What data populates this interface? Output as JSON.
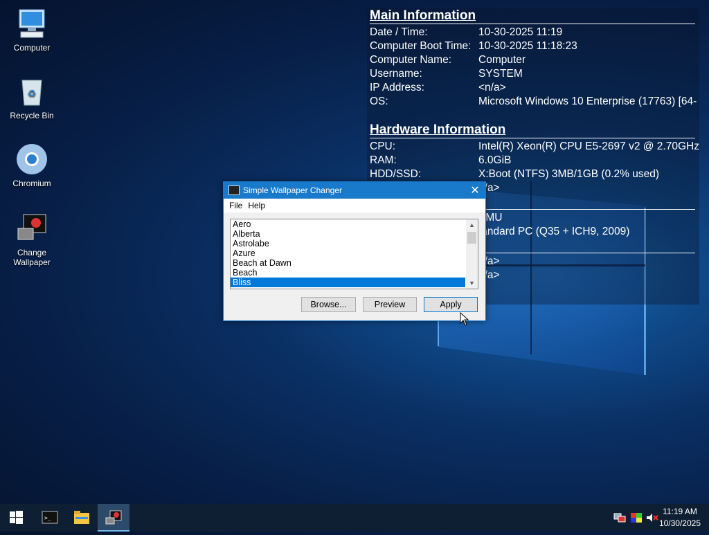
{
  "desktop": {
    "icons": [
      {
        "label": "Computer",
        "icon": "computer-icon"
      },
      {
        "label": "Recycle Bin",
        "icon": "recycle-bin-icon"
      },
      {
        "label": "Chromium",
        "icon": "chromium-icon"
      },
      {
        "label": "Change Wallpaper",
        "icon": "wallpaper-app-icon"
      }
    ]
  },
  "info_panel": {
    "main_title": "Main Information",
    "main_rows": [
      {
        "key": "Date / Time:",
        "value": "10-30-2025 11:19"
      },
      {
        "key": "Computer Boot Time:",
        "value": "10-30-2025 11:18:23"
      },
      {
        "key": "Computer Name:",
        "value": "Computer"
      },
      {
        "key": "Username:",
        "value": "SYSTEM"
      },
      {
        "key": "IP Address:",
        "value": "<n/a>"
      },
      {
        "key": "OS:",
        "value": "Microsoft Windows 10 Enterprise (17763) [64-"
      }
    ],
    "hw_title": "Hardware Information",
    "hw_rows": [
      {
        "key": "CPU:",
        "value": "Intel(R) Xeon(R) CPU E5-2697 v2 @ 2.70GHz"
      },
      {
        "key": "RAM:",
        "value": "6.0GiB"
      },
      {
        "key": "HDD/SSD:",
        "value": "X:Boot (NTFS) 3MB/1GB (0.2% used)"
      },
      {
        "key": "",
        "value": "n/a>"
      }
    ],
    "extra_rows": [
      {
        "value": "EMU"
      },
      {
        "value": "tandard PC (Q35 + ICH9, 2009)"
      },
      {
        "value": "n/a>"
      },
      {
        "value": "n/a>"
      }
    ]
  },
  "dialog": {
    "title": "Simple Wallpaper Changer",
    "close_glyph": "✕",
    "menu": [
      "File",
      "Help"
    ],
    "list_items": [
      "Aero",
      "Alberta",
      "Astrolabe",
      "Azure",
      "Beach at Dawn",
      "Beach",
      "Bliss"
    ],
    "selected_item": "Bliss",
    "buttons": {
      "browse": "Browse...",
      "preview": "Preview",
      "apply": "Apply"
    }
  },
  "taskbar": {
    "items": [
      "start-button",
      "command-prompt-icon",
      "file-explorer-icon",
      "wallpaper-changer-icon"
    ],
    "clock_time": "11:19 AM",
    "clock_date": "10/30/2025"
  },
  "colors": {
    "accent": "#1979ca",
    "selection": "#0078d7",
    "taskbar": "#0f1f33"
  }
}
